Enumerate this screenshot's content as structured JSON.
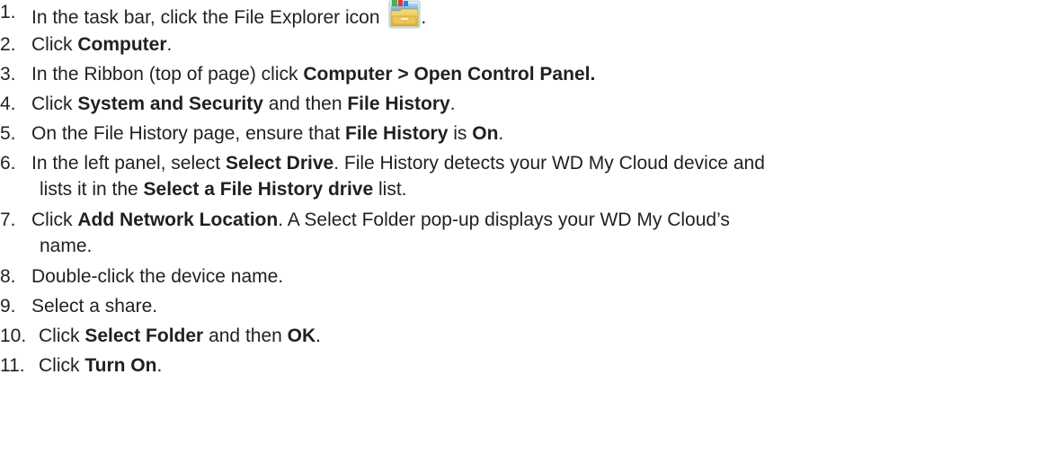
{
  "steps": [
    {
      "num": "1.",
      "parts": [
        {
          "t": "In the task bar, click the File Explorer icon "
        }
      ],
      "after_icon": "."
    },
    {
      "num": "2.",
      "parts": [
        {
          "t": "Click "
        },
        {
          "b": "Computer"
        },
        {
          "t": "."
        }
      ]
    },
    {
      "num": "3.",
      "parts": [
        {
          "t": "In the Ribbon (top of page) click "
        },
        {
          "b": "Computer > Open Control Panel."
        }
      ]
    },
    {
      "num": "4.",
      "parts": [
        {
          "t": "Click "
        },
        {
          "b": "System and Security"
        },
        {
          "t": " and then "
        },
        {
          "b": "File History"
        },
        {
          "t": "."
        }
      ]
    },
    {
      "num": "5.",
      "parts": [
        {
          "t": "On the File History page, ensure that "
        },
        {
          "b": "File History"
        },
        {
          "t": " is "
        },
        {
          "b": "On"
        },
        {
          "t": "."
        }
      ]
    },
    {
      "num": "6.",
      "parts": [
        {
          "t": "In the left panel, select "
        },
        {
          "b": "Select Drive"
        },
        {
          "t": ". File History detects your WD My Cloud device and"
        }
      ],
      "cont": [
        {
          "t": "lists it in the "
        },
        {
          "b": "Select a File History drive"
        },
        {
          "t": " list."
        }
      ]
    },
    {
      "num": "7.",
      "parts": [
        {
          "t": "Click "
        },
        {
          "b": "Add Network Location"
        },
        {
          "t": ". A Select Folder pop-up displays your WD My Cloud’s"
        }
      ],
      "cont": [
        {
          "t": "name."
        }
      ]
    },
    {
      "num": "8.",
      "parts": [
        {
          "t": "Double-click the device name."
        }
      ]
    },
    {
      "num": "9.",
      "parts": [
        {
          "t": "Select a share."
        }
      ]
    },
    {
      "num": "10.",
      "parts": [
        {
          "t": "Click "
        },
        {
          "b": "Select Folder"
        },
        {
          "t": " and then "
        },
        {
          "b": "OK"
        },
        {
          "t": "."
        }
      ]
    },
    {
      "num": "11.",
      "parts": [
        {
          "t": "Click "
        },
        {
          "b": "Turn On"
        },
        {
          "t": "."
        }
      ]
    }
  ],
  "icons": {
    "step1": "file-explorer-icon"
  },
  "colors": {
    "text": "#231f20"
  }
}
